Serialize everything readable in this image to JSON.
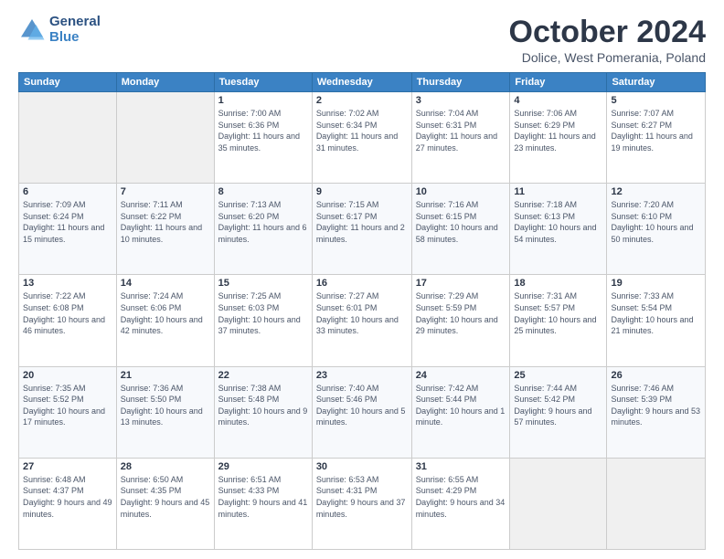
{
  "header": {
    "logo_general": "General",
    "logo_blue": "Blue",
    "month_title": "October 2024",
    "location": "Dolice, West Pomerania, Poland"
  },
  "weekdays": [
    "Sunday",
    "Monday",
    "Tuesday",
    "Wednesday",
    "Thursday",
    "Friday",
    "Saturday"
  ],
  "weeks": [
    [
      {
        "num": "",
        "sunrise": "",
        "sunset": "",
        "daylight": "",
        "empty": true
      },
      {
        "num": "",
        "sunrise": "",
        "sunset": "",
        "daylight": "",
        "empty": true
      },
      {
        "num": "1",
        "sunrise": "Sunrise: 7:00 AM",
        "sunset": "Sunset: 6:36 PM",
        "daylight": "Daylight: 11 hours and 35 minutes."
      },
      {
        "num": "2",
        "sunrise": "Sunrise: 7:02 AM",
        "sunset": "Sunset: 6:34 PM",
        "daylight": "Daylight: 11 hours and 31 minutes."
      },
      {
        "num": "3",
        "sunrise": "Sunrise: 7:04 AM",
        "sunset": "Sunset: 6:31 PM",
        "daylight": "Daylight: 11 hours and 27 minutes."
      },
      {
        "num": "4",
        "sunrise": "Sunrise: 7:06 AM",
        "sunset": "Sunset: 6:29 PM",
        "daylight": "Daylight: 11 hours and 23 minutes."
      },
      {
        "num": "5",
        "sunrise": "Sunrise: 7:07 AM",
        "sunset": "Sunset: 6:27 PM",
        "daylight": "Daylight: 11 hours and 19 minutes."
      }
    ],
    [
      {
        "num": "6",
        "sunrise": "Sunrise: 7:09 AM",
        "sunset": "Sunset: 6:24 PM",
        "daylight": "Daylight: 11 hours and 15 minutes."
      },
      {
        "num": "7",
        "sunrise": "Sunrise: 7:11 AM",
        "sunset": "Sunset: 6:22 PM",
        "daylight": "Daylight: 11 hours and 10 minutes."
      },
      {
        "num": "8",
        "sunrise": "Sunrise: 7:13 AM",
        "sunset": "Sunset: 6:20 PM",
        "daylight": "Daylight: 11 hours and 6 minutes."
      },
      {
        "num": "9",
        "sunrise": "Sunrise: 7:15 AM",
        "sunset": "Sunset: 6:17 PM",
        "daylight": "Daylight: 11 hours and 2 minutes."
      },
      {
        "num": "10",
        "sunrise": "Sunrise: 7:16 AM",
        "sunset": "Sunset: 6:15 PM",
        "daylight": "Daylight: 10 hours and 58 minutes."
      },
      {
        "num": "11",
        "sunrise": "Sunrise: 7:18 AM",
        "sunset": "Sunset: 6:13 PM",
        "daylight": "Daylight: 10 hours and 54 minutes."
      },
      {
        "num": "12",
        "sunrise": "Sunrise: 7:20 AM",
        "sunset": "Sunset: 6:10 PM",
        "daylight": "Daylight: 10 hours and 50 minutes."
      }
    ],
    [
      {
        "num": "13",
        "sunrise": "Sunrise: 7:22 AM",
        "sunset": "Sunset: 6:08 PM",
        "daylight": "Daylight: 10 hours and 46 minutes."
      },
      {
        "num": "14",
        "sunrise": "Sunrise: 7:24 AM",
        "sunset": "Sunset: 6:06 PM",
        "daylight": "Daylight: 10 hours and 42 minutes."
      },
      {
        "num": "15",
        "sunrise": "Sunrise: 7:25 AM",
        "sunset": "Sunset: 6:03 PM",
        "daylight": "Daylight: 10 hours and 37 minutes."
      },
      {
        "num": "16",
        "sunrise": "Sunrise: 7:27 AM",
        "sunset": "Sunset: 6:01 PM",
        "daylight": "Daylight: 10 hours and 33 minutes."
      },
      {
        "num": "17",
        "sunrise": "Sunrise: 7:29 AM",
        "sunset": "Sunset: 5:59 PM",
        "daylight": "Daylight: 10 hours and 29 minutes."
      },
      {
        "num": "18",
        "sunrise": "Sunrise: 7:31 AM",
        "sunset": "Sunset: 5:57 PM",
        "daylight": "Daylight: 10 hours and 25 minutes."
      },
      {
        "num": "19",
        "sunrise": "Sunrise: 7:33 AM",
        "sunset": "Sunset: 5:54 PM",
        "daylight": "Daylight: 10 hours and 21 minutes."
      }
    ],
    [
      {
        "num": "20",
        "sunrise": "Sunrise: 7:35 AM",
        "sunset": "Sunset: 5:52 PM",
        "daylight": "Daylight: 10 hours and 17 minutes."
      },
      {
        "num": "21",
        "sunrise": "Sunrise: 7:36 AM",
        "sunset": "Sunset: 5:50 PM",
        "daylight": "Daylight: 10 hours and 13 minutes."
      },
      {
        "num": "22",
        "sunrise": "Sunrise: 7:38 AM",
        "sunset": "Sunset: 5:48 PM",
        "daylight": "Daylight: 10 hours and 9 minutes."
      },
      {
        "num": "23",
        "sunrise": "Sunrise: 7:40 AM",
        "sunset": "Sunset: 5:46 PM",
        "daylight": "Daylight: 10 hours and 5 minutes."
      },
      {
        "num": "24",
        "sunrise": "Sunrise: 7:42 AM",
        "sunset": "Sunset: 5:44 PM",
        "daylight": "Daylight: 10 hours and 1 minute."
      },
      {
        "num": "25",
        "sunrise": "Sunrise: 7:44 AM",
        "sunset": "Sunset: 5:42 PM",
        "daylight": "Daylight: 9 hours and 57 minutes."
      },
      {
        "num": "26",
        "sunrise": "Sunrise: 7:46 AM",
        "sunset": "Sunset: 5:39 PM",
        "daylight": "Daylight: 9 hours and 53 minutes."
      }
    ],
    [
      {
        "num": "27",
        "sunrise": "Sunrise: 6:48 AM",
        "sunset": "Sunset: 4:37 PM",
        "daylight": "Daylight: 9 hours and 49 minutes."
      },
      {
        "num": "28",
        "sunrise": "Sunrise: 6:50 AM",
        "sunset": "Sunset: 4:35 PM",
        "daylight": "Daylight: 9 hours and 45 minutes."
      },
      {
        "num": "29",
        "sunrise": "Sunrise: 6:51 AM",
        "sunset": "Sunset: 4:33 PM",
        "daylight": "Daylight: 9 hours and 41 minutes."
      },
      {
        "num": "30",
        "sunrise": "Sunrise: 6:53 AM",
        "sunset": "Sunset: 4:31 PM",
        "daylight": "Daylight: 9 hours and 37 minutes."
      },
      {
        "num": "31",
        "sunrise": "Sunrise: 6:55 AM",
        "sunset": "Sunset: 4:29 PM",
        "daylight": "Daylight: 9 hours and 34 minutes."
      },
      {
        "num": "",
        "sunrise": "",
        "sunset": "",
        "daylight": "",
        "empty": true
      },
      {
        "num": "",
        "sunrise": "",
        "sunset": "",
        "daylight": "",
        "empty": true
      }
    ]
  ]
}
